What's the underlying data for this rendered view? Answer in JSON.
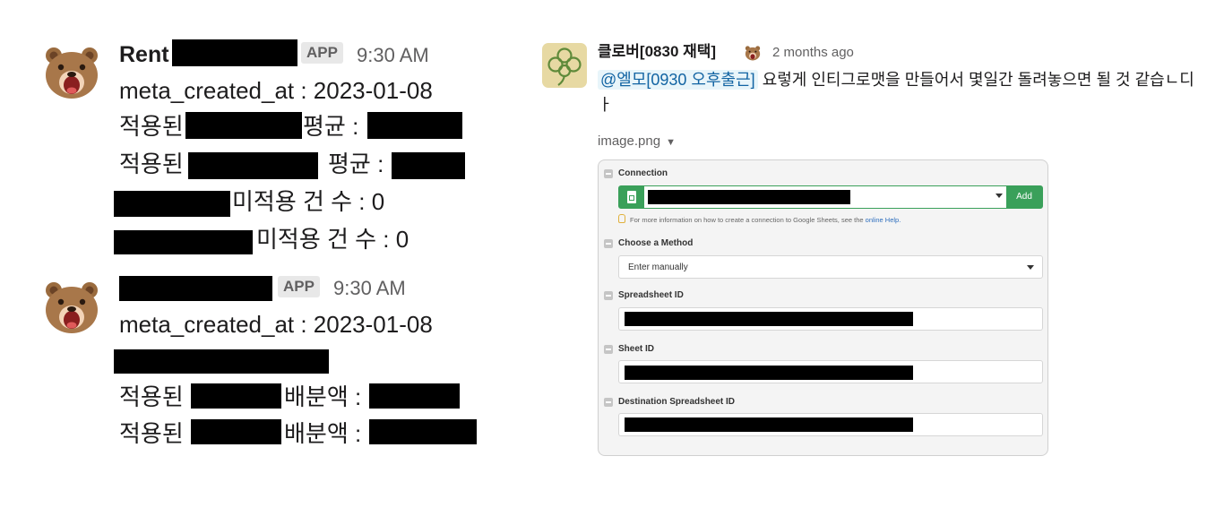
{
  "left_messages": [
    {
      "sender": "Rent",
      "badge": "APP",
      "time": "9:30 AM",
      "lines": [
        "meta_created_at : 2023-01-08",
        "적용된",
        "평균 :",
        "적용된",
        "평균 :",
        "미적용 건 수 : 0",
        "미적용 건 수 : 0"
      ]
    },
    {
      "sender": "",
      "badge": "APP",
      "time": "9:30 AM",
      "lines": [
        "meta_created_at : 2023-01-08",
        "적용된",
        "배분액 :",
        "적용된",
        "배분액 :"
      ]
    }
  ],
  "right_message": {
    "sender": "클로버[0830 재택]",
    "time": "2 months ago",
    "mention": "@엘모[0930 오후출근]",
    "text": " 요렇게 인티그로맷을 만들어서 몇일간 돌려놓으면 될 것 같습ㄴ디ㅏ",
    "attachment": {
      "file_name": "image.png",
      "caret": "▼"
    }
  },
  "preview": {
    "connection_label": "Connection",
    "add_label": "Add",
    "hint_text": "For more information on how to create a connection to Google Sheets, see the",
    "hint_link": "online Help.",
    "method_label": "Choose a Method",
    "method_value": "Enter manually",
    "spreadsheet_label": "Spreadsheet ID",
    "sheet_label": "Sheet ID",
    "dest_label": "Destination Spreadsheet ID"
  },
  "colors": {
    "connection_green": "#3aa05a",
    "mention_blue": "#1264a3",
    "mention_bg": "#e8f5fa"
  }
}
